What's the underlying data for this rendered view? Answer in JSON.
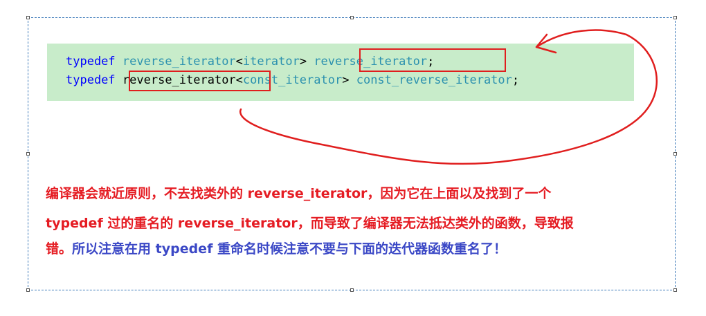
{
  "code": {
    "line1": {
      "keyword": "typedef",
      "type": "reverse_iterator",
      "lt": "<",
      "arg": "iterator",
      "gt": ">",
      "name": "reverse_iterator",
      "semi": ";"
    },
    "line2": {
      "keyword": "typedef",
      "type": "reverse_iterator",
      "lt": "<",
      "arg": "const_iterator",
      "gt": ">",
      "name": "const_reverse_iterator",
      "semi": ";"
    }
  },
  "note": {
    "line1": "编译器会就近原则，不去找类外的 reverse_iterator，因为它在上面以及找到了一个",
    "line2": "typedef 过的重名的 reverse_iterator，而导致了编译器无法抵达类外的函数，导致报",
    "line3_red": "错。",
    "line3_blue": "所以注意在用 typedef 重命名时候注意不要与下面的迭代器函数重名了！"
  },
  "colors": {
    "keyword": "#0000ff",
    "type": "#2b91af",
    "code_background": "#c8ecca",
    "annotation_red": "#e01e1e",
    "note_red": "#e51c23",
    "note_blue": "#3b48c6"
  }
}
